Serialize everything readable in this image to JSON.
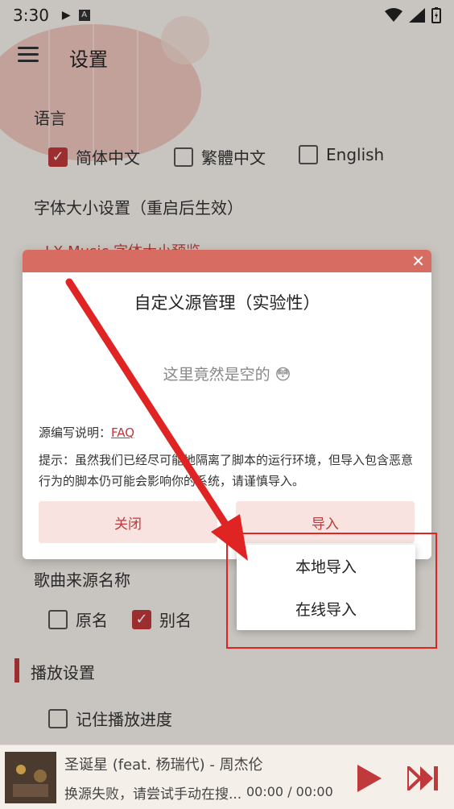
{
  "status_bar": {
    "time": "3:30"
  },
  "header": {
    "title": "设置"
  },
  "settings": {
    "language_label": "语言",
    "languages": [
      {
        "label": "简体中文",
        "checked": true
      },
      {
        "label": "繁體中文",
        "checked": false
      },
      {
        "label": "English",
        "checked": false
      }
    ],
    "font_size_label": "字体大小设置（重启后生效）",
    "font_preview": "LX Music 字体大小预览",
    "song_source_name_label": "歌曲来源名称",
    "song_source_options": [
      {
        "label": "原名",
        "checked": false
      },
      {
        "label": "别名",
        "checked": true
      }
    ],
    "playback_section_title": "播放设置",
    "remember_progress_label": "记住播放进度"
  },
  "dialog": {
    "title": "自定义源管理（实验性）",
    "empty_text": "这里竟然是空的 😳",
    "note_prefix": "源编写说明：",
    "note_link": "FAQ",
    "tip": "提示：虽然我们已经尽可能地隔离了脚本的运行环境，但导入包含恶意行为的脚本仍可能会影响你的系统，请谨慎导入。",
    "close_button": "关闭",
    "import_button": "导入"
  },
  "import_menu": {
    "items": [
      "本地导入",
      "在线导入"
    ]
  },
  "player": {
    "song_title": "圣诞星 (feat. 杨瑞代) - 周杰伦",
    "status": "换源失败，请尝试手动在搜...",
    "time": "00:00 / 00:00"
  },
  "colors": {
    "accent": "#c0393b",
    "dialog_header": "#d76c62",
    "annotation": "#e02424"
  }
}
